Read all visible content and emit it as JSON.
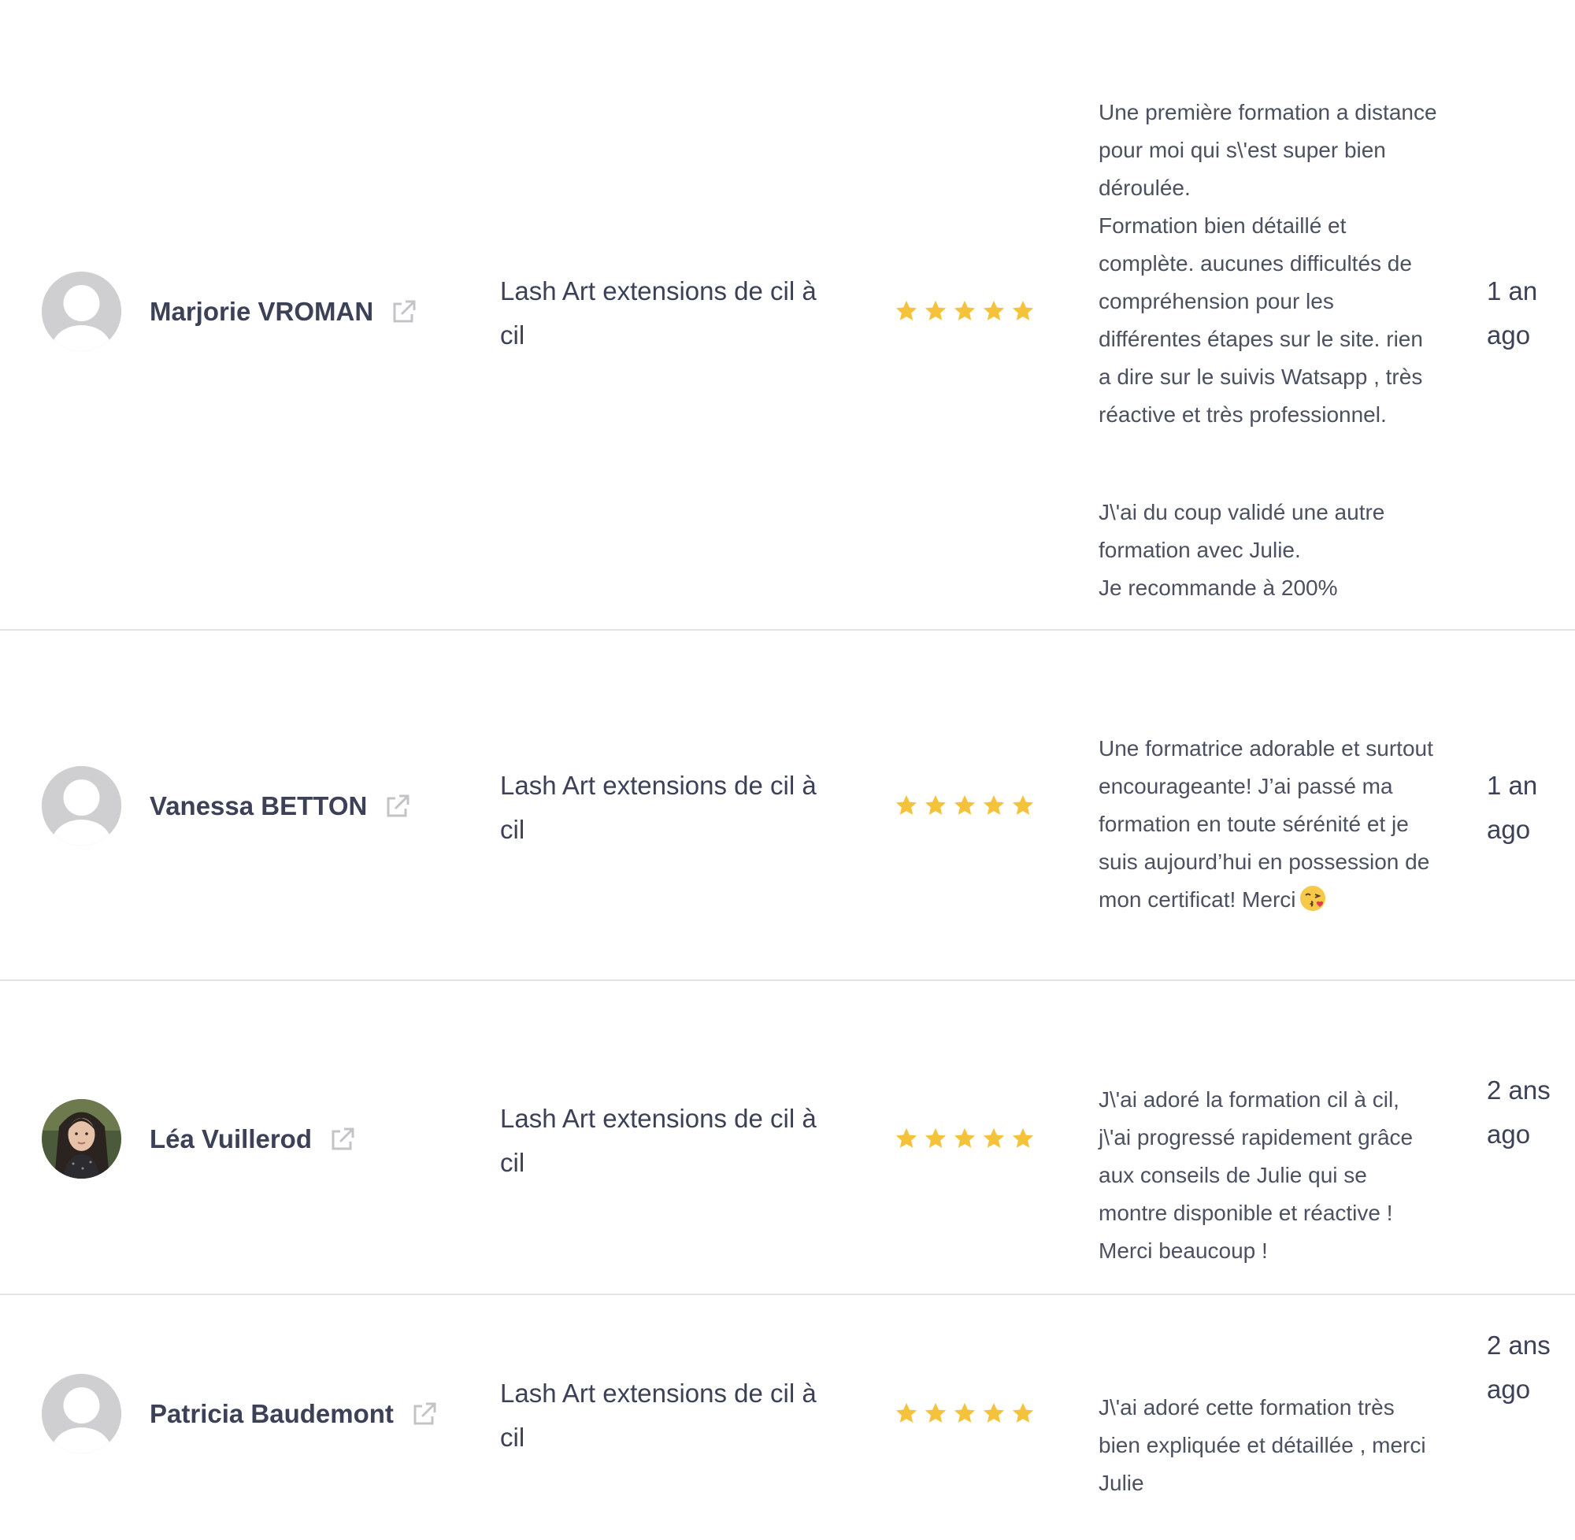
{
  "colors": {
    "star": "#f5c33b",
    "text": "#3c4157",
    "divider": "#e3e3e6",
    "avatar_placeholder": "#cfcfd1"
  },
  "reviews": [
    {
      "name": "Marjorie VROMAN",
      "course": "Lash Art extensions de cil à cil",
      "rating": 5,
      "comment_paragraphs": [
        "Une première formation a distance pour moi qui s\\'est super bien déroulée.\nFormation bien détaillé et complète. aucunes difficultés de compréhension pour les différentes étapes sur le site. rien a dire sur le suivis Watsapp , très réactive et très professionnel.",
        "J\\'ai du coup validé une autre formation avec Julie.\nJe recommande à 200%"
      ],
      "date": "1 an ago",
      "avatar": "placeholder-person-icon"
    },
    {
      "name": "Vanessa BETTON",
      "course": "Lash Art extensions de cil à cil",
      "rating": 5,
      "comment_paragraphs": [
        "Une formatrice adorable et surtout encourageante! J’ai passé ma formation en toute sérénité et je suis aujourd’hui en possession de mon certificat! Merci"
      ],
      "comment_emoji": "kiss-emoji-icon",
      "date": "1 an ago",
      "avatar": "placeholder-person-icon"
    },
    {
      "name": "Léa Vuillerod",
      "course": "Lash Art extensions de cil à cil",
      "rating": 5,
      "comment_paragraphs": [
        "J\\'ai adoré la formation cil à cil, j\\'ai progressé rapidement grâce aux conseils de Julie qui se montre disponible et réactive ! Merci beaucoup !"
      ],
      "date": "2 ans ago",
      "avatar": "photo-avatar"
    },
    {
      "name": "Patricia Baudemont",
      "course": "Lash Art extensions de cil à cil",
      "rating": 5,
      "comment_paragraphs": [
        "J\\'ai adoré cette formation très bien expliquée et détaillée , merci Julie"
      ],
      "date": "2 ans ago",
      "avatar": "placeholder-person-icon"
    }
  ]
}
